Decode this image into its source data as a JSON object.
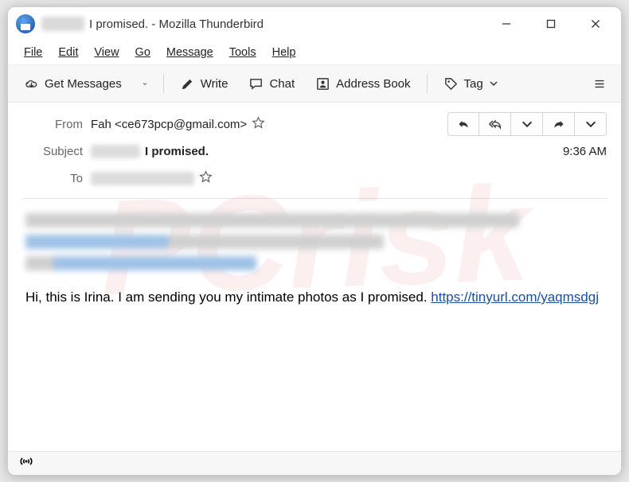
{
  "window": {
    "title_suffix": " I promised. - Mozilla Thunderbird"
  },
  "menu": {
    "file": "File",
    "edit": "Edit",
    "view": "View",
    "go": "Go",
    "message": "Message",
    "tools": "Tools",
    "help": "Help"
  },
  "toolbar": {
    "get_messages": "Get Messages",
    "write": "Write",
    "chat": "Chat",
    "address_book": "Address Book",
    "tag": "Tag"
  },
  "headers": {
    "from_label": "From",
    "from_value": "Fah <ce673pcp@gmail.com>",
    "subject_label": "Subject",
    "subject_value": " I promised.",
    "to_label": "To",
    "time": "9:36 AM"
  },
  "body": {
    "text_before_link": "Hi, this is Irina. I am sending you my intimate photos as I promised.  ",
    "link_text": "https://tinyurl.com/yaqmsdgj"
  }
}
